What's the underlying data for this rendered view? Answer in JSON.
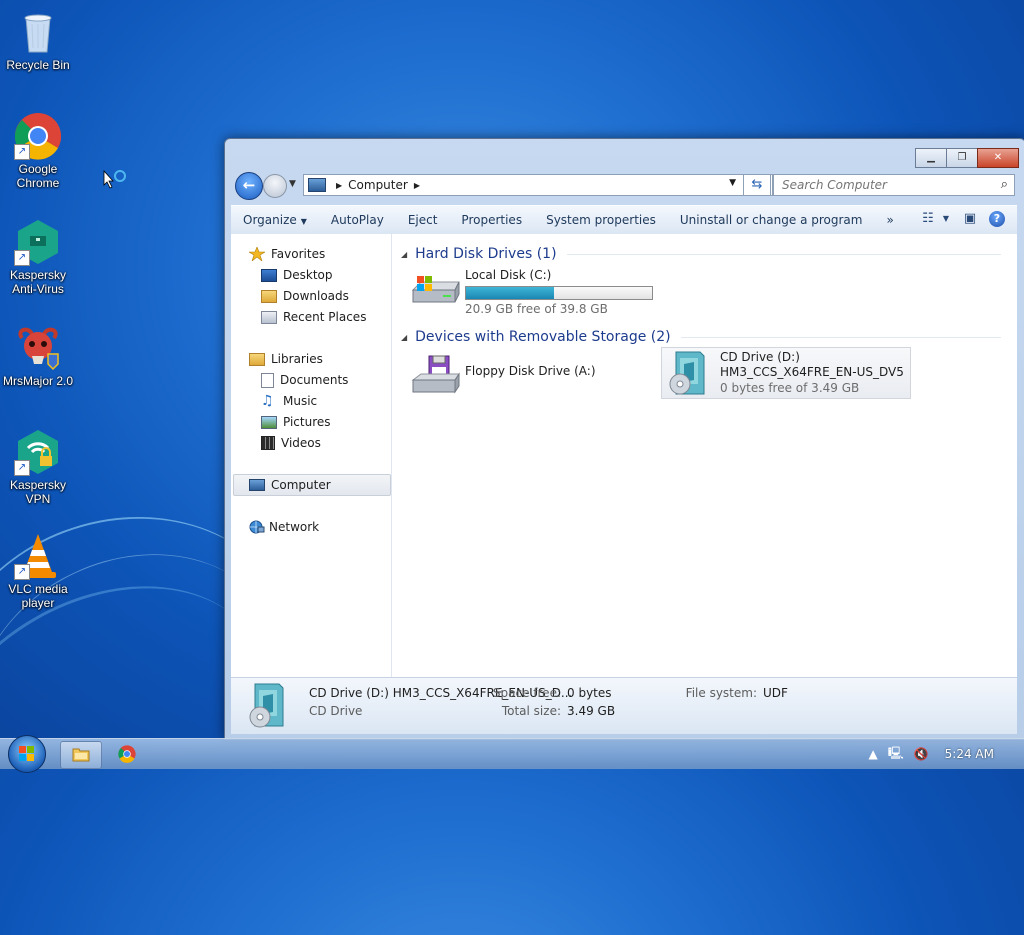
{
  "desktop": {
    "icons": [
      {
        "label": "Recycle Bin"
      },
      {
        "label": "Google Chrome"
      },
      {
        "label": "Kaspersky Anti-Virus"
      },
      {
        "label": "MrsMajor 2.0"
      },
      {
        "label": "Kaspersky VPN"
      },
      {
        "label": "VLC media player"
      }
    ]
  },
  "window": {
    "address": {
      "crumb": "Computer"
    },
    "search": {
      "placeholder": "Search Computer"
    },
    "toolbar": {
      "organize": "Organize",
      "autoplay": "AutoPlay",
      "eject": "Eject",
      "properties": "Properties",
      "system_properties": "System properties",
      "uninstall": "Uninstall or change a program",
      "more": "»"
    },
    "nav": {
      "favorites": "Favorites",
      "desktop": "Desktop",
      "downloads": "Downloads",
      "recent": "Recent Places",
      "libraries": "Libraries",
      "documents": "Documents",
      "music": "Music",
      "pictures": "Pictures",
      "videos": "Videos",
      "computer": "Computer",
      "network": "Network"
    },
    "groups": {
      "hdd": "Hard Disk Drives (1)",
      "removable": "Devices with Removable Storage (2)"
    },
    "drives": {
      "local": {
        "name": "Local Disk (C:)",
        "free": "20.9 GB free of 39.8 GB",
        "used_fraction": 0.475
      },
      "floppy": {
        "name": "Floppy Disk Drive (A:)"
      },
      "cd": {
        "name": "CD Drive (D:)",
        "label": "HM3_CCS_X64FRE_EN-US_DV5",
        "free": "0 bytes free of 3.49 GB"
      }
    },
    "details": {
      "title": "CD Drive (D:) HM3_CCS_X64FRE_EN-US_D...",
      "type": "CD Drive",
      "space_free_label": "Space free:",
      "space_free": "0 bytes",
      "total_size_label": "Total size:",
      "total_size": "3.49 GB",
      "fs_label": "File system:",
      "fs": "UDF"
    }
  },
  "taskbar": {
    "clock": "5:24 AM"
  },
  "colors": {
    "accent": "#1e3c8e",
    "progress": "#1a86b4",
    "desktop": "#1f6fd1"
  }
}
